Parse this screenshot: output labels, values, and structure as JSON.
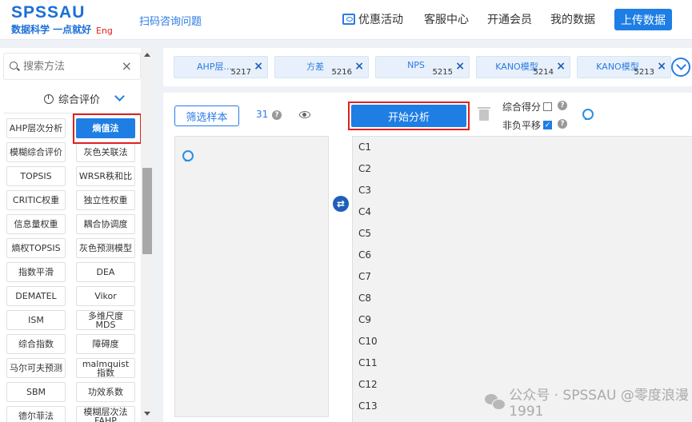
{
  "header": {
    "logo": "SPSSAU",
    "logo_sub": "数据科学 一点就好",
    "lang": "Eng",
    "scan_link": "扫码咨询问题",
    "nav": {
      "promo": "优惠活动",
      "service": "客服中心",
      "vip": "开通会员",
      "my_data": "我的数据"
    },
    "upload": "上传数据"
  },
  "sidebar": {
    "search_placeholder": "搜索方法",
    "clear": "×",
    "category": "综合评价",
    "methods": [
      "AHP层次分析",
      "熵值法",
      "模糊综合评价",
      "灰色关联法",
      "TOPSIS",
      "WRSR秩和比",
      "CRITIC权重",
      "独立性权重",
      "信息量权重",
      "耦合协调度",
      "熵权TOPSIS",
      "灰色预测模型",
      "指数平滑",
      "DEA",
      "DEMATEL",
      "Vikor",
      "ISM",
      "多维尺度MDS",
      "综合指数",
      "障碍度",
      "马尔可夫预测",
      "malmquist指数",
      "SBM",
      "功效系数",
      "德尔菲法",
      "模糊层次法FAHP"
    ]
  },
  "tabs": [
    {
      "label": "AHP层...",
      "count": "5217"
    },
    {
      "label": "方差",
      "count": "5216"
    },
    {
      "label": "NPS",
      "count": "5215"
    },
    {
      "label": "KANO模型",
      "count": "5214"
    },
    {
      "label": "KANO模型",
      "count": "5213"
    }
  ],
  "tab_close": "×",
  "main": {
    "filter": "筛选样本",
    "count": "31",
    "help": "?",
    "start": "开始分析",
    "opt_score": "综合得分",
    "opt_shift": "非负平移",
    "swap": "⇄"
  },
  "variables": [
    "C1",
    "C2",
    "C3",
    "C4",
    "C5",
    "C6",
    "C7",
    "C8",
    "C9",
    "C10",
    "C11",
    "C12",
    "C13"
  ],
  "watermark": "公众号 · SPSSAU   @零度浪漫1991",
  "colors": {
    "accent": "#1e7ee4",
    "highlight": "#e02020"
  }
}
